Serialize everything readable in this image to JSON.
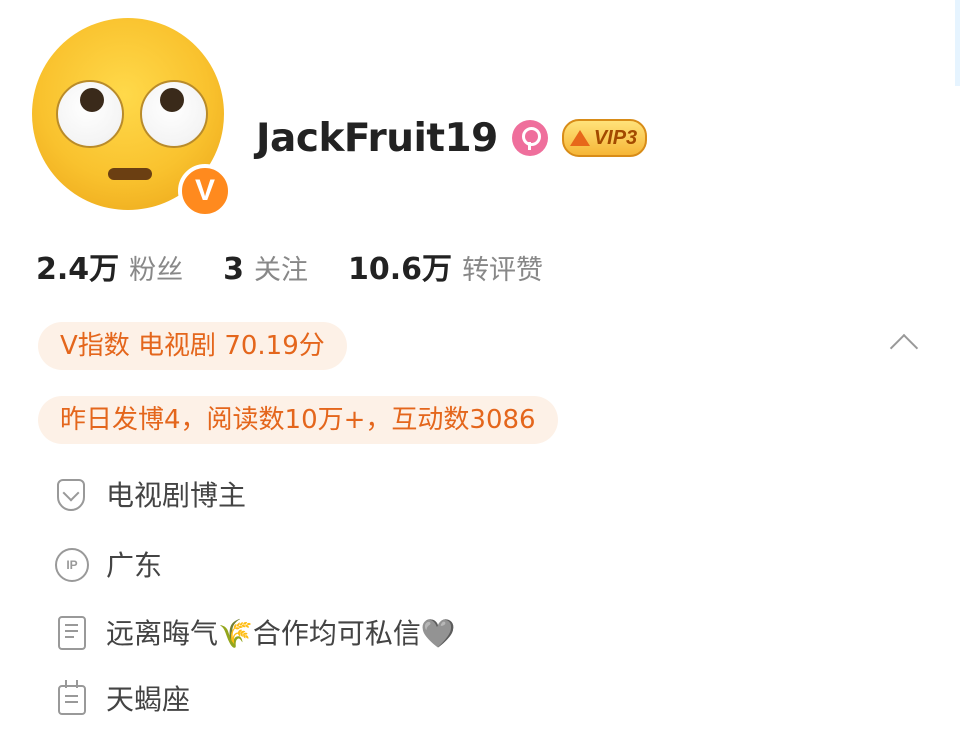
{
  "profile": {
    "username": "JackFruit19",
    "vip_label": "VIP3",
    "verified_badge": "V"
  },
  "stats": [
    {
      "value": "2.4万",
      "label": "粉丝"
    },
    {
      "value": "3",
      "label": "关注"
    },
    {
      "value": "10.6万",
      "label": "转评赞"
    }
  ],
  "chips": {
    "v_index": "V指数 电视剧 70.19分",
    "yesterday": "昨日发博4，阅读数10万+，互动数3086"
  },
  "info": {
    "tag": "电视剧博主",
    "ip_icon_text": "IP",
    "ip_location": "广东",
    "bio": "远离晦气🌾合作均可私信🩶",
    "zodiac": "天蝎座"
  },
  "colors": {
    "accent_orange": "#e4661c",
    "chip_bg": "#fdf1e7",
    "badge_orange": "#ff8a1e",
    "gender_pink": "#ef6f9c",
    "vip_gold": "#f6b637"
  },
  "icons": {
    "avatar": "rolling-eyes-emoji",
    "gender": "female-icon",
    "vip": "crown-icon",
    "expand": "chevron-up-icon",
    "tag": "shield-v-icon",
    "ip": "ip-icon",
    "bio": "document-icon",
    "zodiac": "calendar-icon"
  }
}
